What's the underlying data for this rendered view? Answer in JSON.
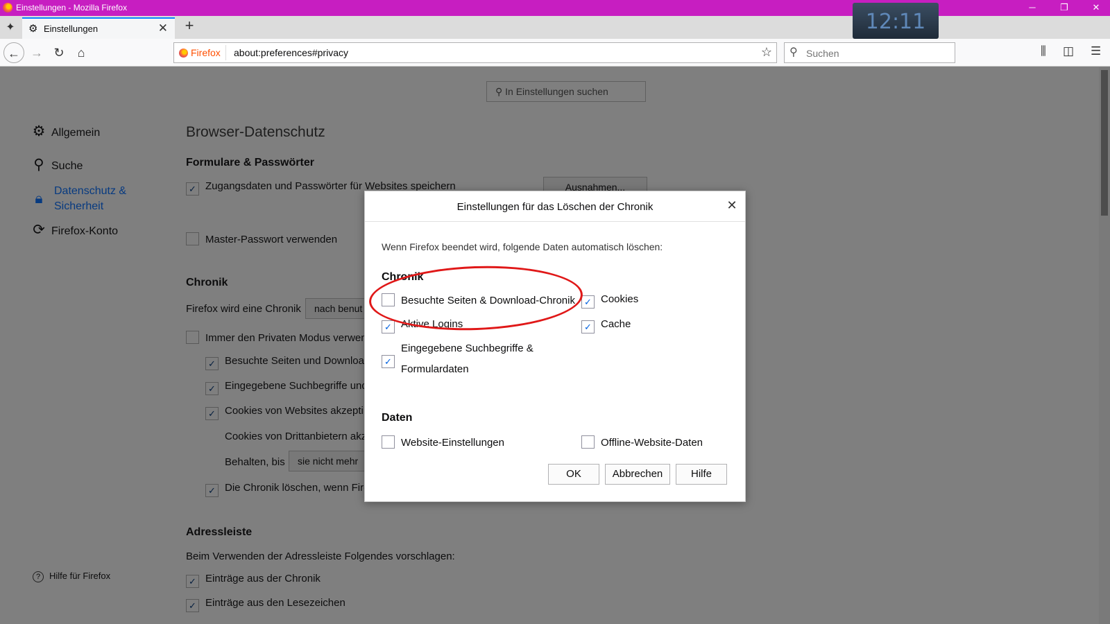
{
  "window": {
    "title": "Einstellungen - Mozilla Firefox",
    "clock": "12:11",
    "controls": {
      "minimize": "─",
      "restore": "❐",
      "close": "✕"
    }
  },
  "tabs": [
    {
      "label": "Einstellungen",
      "close": "✕"
    }
  ],
  "newtab": "+",
  "toolbar": {
    "url_badge": "Firefox",
    "url": "about:preferences#privacy",
    "search_placeholder": "Suchen"
  },
  "prefs": {
    "search_placeholder": "In Einstellungen suchen",
    "nav": [
      {
        "label": "Allgemein",
        "icon": "gear-icon"
      },
      {
        "label": "Suche",
        "icon": "search-icon"
      },
      {
        "label": "Datenschutz &",
        "label2": "Sicherheit",
        "icon": "lock-icon",
        "active": true
      },
      {
        "label": "Firefox-Konto",
        "icon": "sync-icon"
      }
    ],
    "help_link": "Hilfe für Firefox",
    "heading": "Browser-Datenschutz",
    "forms_section": "Formulare & Passwörter",
    "save_logins": "Zugangsdaten und Passwörter für Websites speichern",
    "exceptions_button": "Ausnahmen...",
    "master_password": "Master-Passwort verwenden",
    "history_section": "Chronik",
    "history_mode_label": "Firefox wird eine Chronik",
    "history_mode_value": "nach benut",
    "private_mode": "Immer den Privaten Modus verwen",
    "visited_pages": "Besuchte Seiten und Downloa",
    "search_form": "Eingegebene Suchbegriffe und",
    "accept_cookies": "Cookies von Websites akzepti",
    "third_party": "Cookies von Drittanbietern akz",
    "keep_until_label": "Behalten, bis",
    "keep_until_value": "sie nicht mehr",
    "clear_on_close": "Die Chronik löschen, wenn Fire",
    "address_section": "Adressleiste",
    "address_suggest": "Beim Verwenden der Adressleiste Folgendes vorschlagen:",
    "history_entries": "Einträge aus der Chronik",
    "bookmark_entries": "Einträge aus den Lesezeichen"
  },
  "dialog": {
    "title": "Einstellungen für das Löschen der Chronik",
    "intro": "Wenn Firefox beendet wird, folgende Daten automatisch löschen:",
    "history_heading": "Chronik",
    "items_history": [
      {
        "label": "Besuchte Seiten & Download-Chronik",
        "checked": false
      },
      {
        "label": "Cookies",
        "checked": true
      },
      {
        "label": "Aktive Logins",
        "checked": true
      },
      {
        "label": "Cache",
        "checked": true
      },
      {
        "label": "Eingegebene Suchbegriffe &",
        "label2": "Formulardaten",
        "checked": true
      }
    ],
    "data_heading": "Daten",
    "items_data": [
      {
        "label": "Website-Einstellungen",
        "checked": false
      },
      {
        "label": "Offline-Website-Daten",
        "checked": false
      }
    ],
    "buttons": {
      "ok": "OK",
      "cancel": "Abbrechen",
      "help": "Hilfe"
    }
  },
  "colors": {
    "titlebar": "#c71ec1",
    "annotation": "#e01818",
    "accent": "#0a84ff"
  }
}
